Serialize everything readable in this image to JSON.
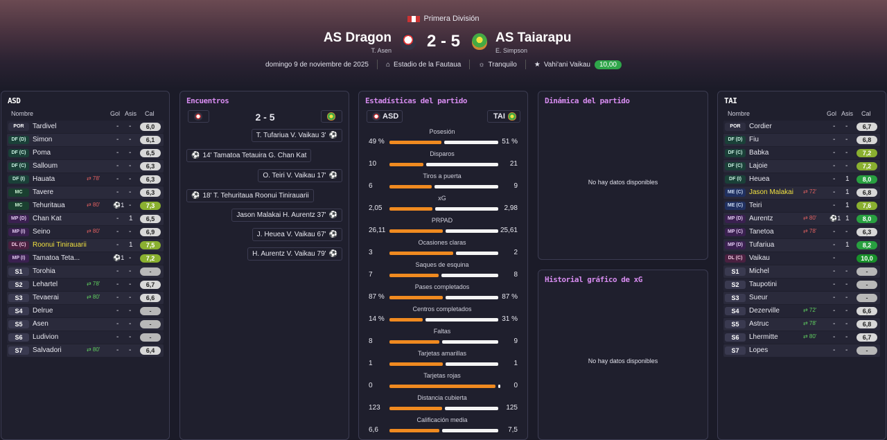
{
  "header": {
    "league": "Primera División",
    "home_team": "AS Dragon",
    "home_coach": "T. Asen",
    "away_team": "AS Taiarapu",
    "away_coach": "E. Simpson",
    "score": "2 - 5",
    "date": "domingo 9 de noviembre de 2025",
    "stadium": "Estadio de la Fautaua",
    "weather": "Tranquilo",
    "motm": "Vahi'ani Vaikau",
    "motm_rating": "10,00"
  },
  "home_panel": {
    "title": "ASD",
    "col_name": "Nombre",
    "col_goals": "Gol",
    "col_assists": "Asis",
    "col_rating": "Cal",
    "players": [
      {
        "pos": "POR",
        "name": "Tardivel",
        "g": "-",
        "a": "-",
        "r": "6,0",
        "rc": "",
        "pc": "gk"
      },
      {
        "pos": "DF (D)",
        "name": "Simon",
        "g": "-",
        "a": "-",
        "r": "6,1",
        "rc": "",
        "pc": "df"
      },
      {
        "pos": "DF (C)",
        "name": "Poma",
        "g": "-",
        "a": "-",
        "r": "6,5",
        "rc": "",
        "pc": "df"
      },
      {
        "pos": "DF (C)",
        "name": "Salloum",
        "g": "-",
        "a": "-",
        "r": "6,3",
        "rc": "",
        "pc": "df"
      },
      {
        "pos": "DF (I)",
        "name": "Hauata",
        "sub": "78'",
        "g": "-",
        "a": "-",
        "r": "6,3",
        "rc": "",
        "pc": "df"
      },
      {
        "pos": "MC",
        "name": "Tavere",
        "g": "-",
        "a": "-",
        "r": "6,3",
        "rc": "",
        "pc": "mc"
      },
      {
        "pos": "MC",
        "name": "Tehuritaua",
        "sub": "80'",
        "ball": "1",
        "g": "",
        "a": "-",
        "r": "7,3",
        "rc": "g1",
        "pc": "mc"
      },
      {
        "pos": "MP (D)",
        "name": "Chan Kat",
        "g": "-",
        "a": "1",
        "r": "6,5",
        "rc": "",
        "pc": "mp"
      },
      {
        "pos": "MP (I)",
        "name": "Seino",
        "sub": "80'",
        "g": "-",
        "a": "-",
        "r": "6,9",
        "rc": "",
        "pc": "mp"
      },
      {
        "pos": "DL (C)",
        "name": "Roonui Tinirauarii",
        "hl": true,
        "g": "-",
        "a": "1",
        "r": "7,5",
        "rc": "g1",
        "pc": "dl"
      },
      {
        "pos": "MP (I)",
        "name": "Tamatoa Teta...",
        "ball": "1",
        "g": "",
        "a": "-",
        "r": "7,2",
        "rc": "g1",
        "pc": "mp"
      },
      {
        "pos": "S1",
        "name": "Torohia",
        "g": "-",
        "a": "-",
        "r": "-",
        "rc": "nd",
        "pc": "sub"
      },
      {
        "pos": "S2",
        "name": "Lehartel",
        "subin": "78'",
        "g": "-",
        "a": "-",
        "r": "6,7",
        "rc": "",
        "pc": "sub"
      },
      {
        "pos": "S3",
        "name": "Tevaerai",
        "subin": "80'",
        "g": "-",
        "a": "-",
        "r": "6,6",
        "rc": "",
        "pc": "sub"
      },
      {
        "pos": "S4",
        "name": "Delrue",
        "g": "-",
        "a": "-",
        "r": "-",
        "rc": "nd",
        "pc": "sub"
      },
      {
        "pos": "S5",
        "name": "Asen",
        "g": "-",
        "a": "-",
        "r": "-",
        "rc": "nd",
        "pc": "sub"
      },
      {
        "pos": "S6",
        "name": "Ludivion",
        "g": "-",
        "a": "-",
        "r": "-",
        "rc": "nd",
        "pc": "sub"
      },
      {
        "pos": "S7",
        "name": "Salvadori",
        "subin": "80'",
        "g": "-",
        "a": "-",
        "r": "6,4",
        "rc": "",
        "pc": "sub"
      }
    ]
  },
  "away_panel": {
    "title": "TAI",
    "col_name": "Nombre",
    "col_goals": "Gol",
    "col_assists": "Asis",
    "col_rating": "Cal",
    "players": [
      {
        "pos": "POR",
        "name": "Cordier",
        "g": "-",
        "a": "-",
        "r": "6,7",
        "rc": "",
        "pc": "gk"
      },
      {
        "pos": "DF (D)",
        "name": "Fiu",
        "g": "-",
        "a": "-",
        "r": "6,8",
        "rc": "",
        "pc": "df"
      },
      {
        "pos": "DF (C)",
        "name": "Babka",
        "g": "-",
        "a": "-",
        "r": "7,2",
        "rc": "g1",
        "pc": "df"
      },
      {
        "pos": "DF (C)",
        "name": "Lajoie",
        "g": "-",
        "a": "-",
        "r": "7,2",
        "rc": "g1",
        "pc": "df"
      },
      {
        "pos": "DF (I)",
        "name": "Heuea",
        "g": "-",
        "a": "1",
        "r": "8,0",
        "rc": "g2",
        "pc": "df"
      },
      {
        "pos": "ME (C)",
        "name": "Jason Malakai",
        "hl": true,
        "sub": "72'",
        "g": "-",
        "a": "1",
        "r": "6,8",
        "rc": "",
        "pc": "me"
      },
      {
        "pos": "ME (C)",
        "name": "Teiri",
        "g": "-",
        "a": "1",
        "r": "7,6",
        "rc": "g1",
        "pc": "me"
      },
      {
        "pos": "MP (D)",
        "name": "Aurentz",
        "sub": "80'",
        "ball": "1",
        "g": "",
        "a": "1",
        "r": "8,0",
        "rc": "g2",
        "pc": "mp"
      },
      {
        "pos": "MP (C)",
        "name": "Tanetoa",
        "sub": "78'",
        "g": "-",
        "a": "-",
        "r": "6,3",
        "rc": "",
        "pc": "mp"
      },
      {
        "pos": "MP (D)",
        "name": "Tufariua",
        "g": "-",
        "a": "1",
        "r": "8,2",
        "rc": "g2",
        "pc": "mp"
      },
      {
        "pos": "DL (C)",
        "name": "Vaikau",
        "g": "-",
        "a": "",
        "r": "10,0",
        "rc": "g3",
        "pc": "dl"
      },
      {
        "pos": "S1",
        "name": "Michel",
        "g": "-",
        "a": "-",
        "r": "-",
        "rc": "nd",
        "pc": "sub"
      },
      {
        "pos": "S2",
        "name": "Taupotini",
        "g": "-",
        "a": "-",
        "r": "-",
        "rc": "nd",
        "pc": "sub"
      },
      {
        "pos": "S3",
        "name": "Sueur",
        "g": "-",
        "a": "-",
        "r": "-",
        "rc": "nd",
        "pc": "sub"
      },
      {
        "pos": "S4",
        "name": "Dezerville",
        "subin": "72'",
        "g": "-",
        "a": "-",
        "r": "6,6",
        "rc": "",
        "pc": "sub"
      },
      {
        "pos": "S5",
        "name": "Astruc",
        "subin": "78'",
        "g": "-",
        "a": "-",
        "r": "6,8",
        "rc": "",
        "pc": "sub"
      },
      {
        "pos": "S6",
        "name": "Lhermitte",
        "subin": "80'",
        "g": "-",
        "a": "-",
        "r": "6,7",
        "rc": "",
        "pc": "sub"
      },
      {
        "pos": "S7",
        "name": "Lopes",
        "g": "-",
        "a": "-",
        "r": "-",
        "rc": "nd",
        "pc": "sub"
      }
    ]
  },
  "events_panel": {
    "title": "Encuentros",
    "score": "2 - 5",
    "events": [
      {
        "side": "away",
        "text": "T. Tufariua V. Vaikau 3'"
      },
      {
        "side": "home",
        "text": "14' Tamatoa Tetauira G. Chan Kat"
      },
      {
        "side": "away",
        "text": "O. Teiri V. Vaikau 17'"
      },
      {
        "side": "home",
        "text": "18' T. Tehuritaua Roonui Tinirauarii"
      },
      {
        "side": "away",
        "text": "Jason Malakai H. Aurentz 37'"
      },
      {
        "side": "away",
        "text": "J. Heuea V. Vaikau 67'"
      },
      {
        "side": "away",
        "text": "H. Aurentz V. Vaikau 79'"
      }
    ]
  },
  "stats_panel": {
    "title": "Estadísticas del partido",
    "home_label": "ASD",
    "away_label": "TAI",
    "stats": [
      {
        "label": "Posesión",
        "h": "49 %",
        "a": "51 %",
        "hv": 49,
        "av": 51
      },
      {
        "label": "Disparos",
        "h": "10",
        "a": "21",
        "hv": 10,
        "av": 21
      },
      {
        "label": "Tiros a puerta",
        "h": "6",
        "a": "9",
        "hv": 6,
        "av": 9
      },
      {
        "label": "xG",
        "h": "2,05",
        "a": "2,98",
        "hv": 2.05,
        "av": 2.98
      },
      {
        "label": "PRPAD",
        "h": "26,11",
        "a": "25,61",
        "hv": 26.11,
        "av": 25.61
      },
      {
        "label": "Ocasiones claras",
        "h": "3",
        "a": "2",
        "hv": 3,
        "av": 2
      },
      {
        "label": "Saques de esquina",
        "h": "7",
        "a": "8",
        "hv": 7,
        "av": 8
      },
      {
        "label": "Pases completados",
        "h": "87 %",
        "a": "87 %",
        "hv": 87,
        "av": 87
      },
      {
        "label": "Centros completados",
        "h": "14 %",
        "a": "31 %",
        "hv": 14,
        "av": 31
      },
      {
        "label": "Faltas",
        "h": "8",
        "a": "9",
        "hv": 8,
        "av": 9
      },
      {
        "label": "Tarjetas amarillas",
        "h": "1",
        "a": "1",
        "hv": 1,
        "av": 1
      },
      {
        "label": "Tarjetas rojas",
        "h": "0",
        "a": "0",
        "hv": 0,
        "av": 0
      },
      {
        "label": "Distancia cubierta",
        "h": "123",
        "a": "125",
        "hv": 123,
        "av": 125
      },
      {
        "label": "Calificación media",
        "h": "6,6",
        "a": "7,5",
        "hv": 6.6,
        "av": 7.5
      }
    ]
  },
  "dynamics_panel": {
    "title": "Dinámica del partido",
    "empty": "No hay datos disponibles"
  },
  "xg_panel": {
    "title": "Historial gráfico de xG",
    "empty": "No hay datos disponibles"
  }
}
